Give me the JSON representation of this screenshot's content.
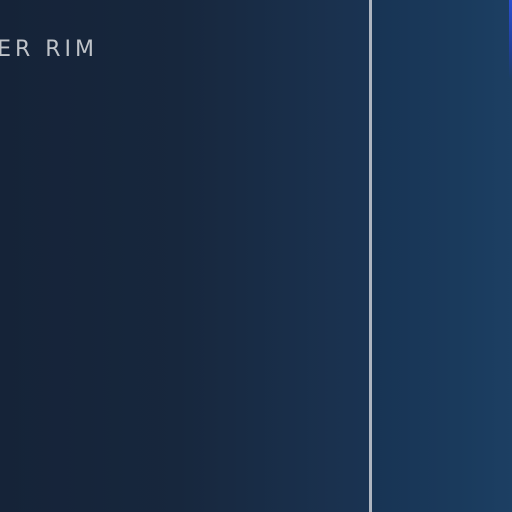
{
  "heading": {
    "text": "ER RIM"
  },
  "colors": {
    "background_left": "#152338",
    "background_right": "#1c3c62",
    "divider": "#c9cdd3",
    "heading_text": "#bfc3c8",
    "edge_accent": "#2a4fd0"
  }
}
